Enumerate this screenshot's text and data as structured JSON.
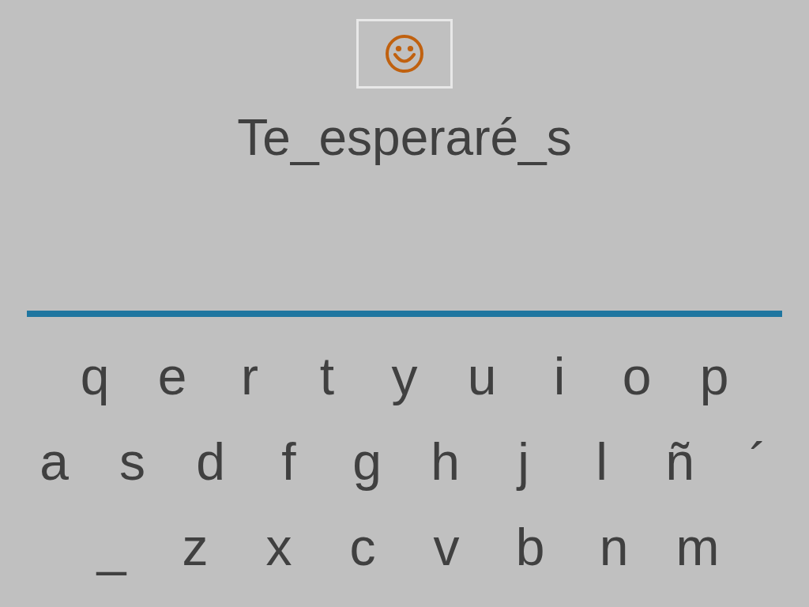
{
  "prompt": {
    "text": "Te_esperaré_s"
  },
  "keyboard": {
    "rows": [
      [
        "q",
        "e",
        "r",
        "t",
        "y",
        "u",
        "i",
        "o",
        "p"
      ],
      [
        "a",
        "s",
        "d",
        "f",
        "g",
        "h",
        "j",
        "l",
        "ñ",
        "´"
      ],
      [
        "_",
        "z",
        "x",
        "c",
        "v",
        "b",
        "n",
        "m"
      ]
    ]
  }
}
